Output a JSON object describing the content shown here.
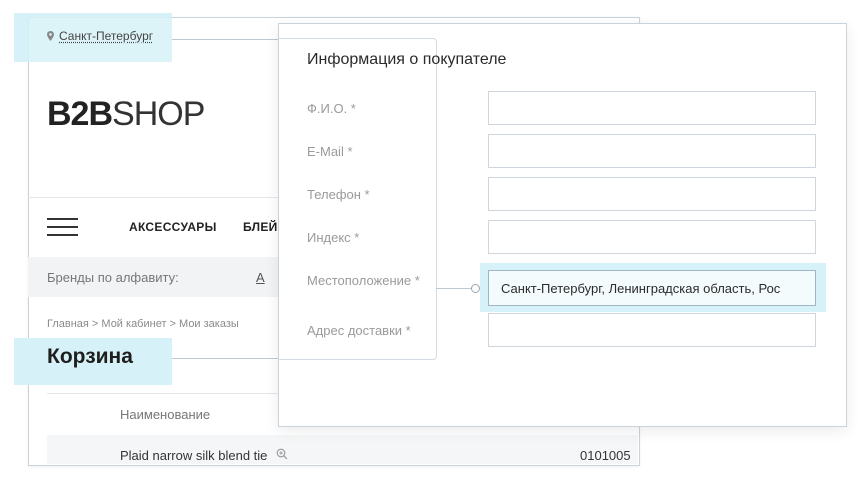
{
  "header": {
    "city": "Санкт-Петербург",
    "logo_bold": "B2B",
    "logo_light": "SHOP"
  },
  "nav": {
    "items": [
      "АКСЕССУАРЫ",
      "БЛЕЙ"
    ]
  },
  "brands": {
    "label": "Бренды по алфавиту:",
    "letter": "A"
  },
  "breadcrumb": "Главная > Мой кабинет > Мои заказы",
  "page_title": "Корзина",
  "table": {
    "header_name": "Наименование",
    "rows": [
      {
        "name": "Plaid narrow silk blend tie",
        "code": "0101005"
      }
    ]
  },
  "form": {
    "title": "Информация о покупателе",
    "fields": [
      {
        "label": "Ф.И.О. *",
        "value": ""
      },
      {
        "label": "E-Mail *",
        "value": ""
      },
      {
        "label": "Телефон *",
        "value": ""
      },
      {
        "label": "Индекс *",
        "value": ""
      },
      {
        "label": "Местоположение *",
        "value": "Санкт-Петербург, Ленинградская область, Рос"
      },
      {
        "label": "Адрес доставки *",
        "value": ""
      }
    ]
  },
  "colors": {
    "highlight": "#d6f1f7",
    "border": "#c9d3dc"
  },
  "icons": [
    "location-pin-icon",
    "hamburger-menu-icon",
    "zoom-icon"
  ]
}
